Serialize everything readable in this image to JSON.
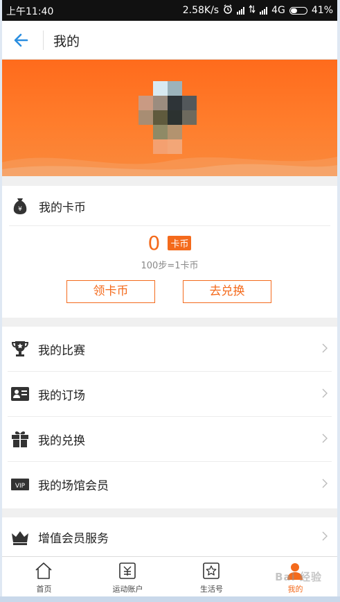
{
  "status_bar": {
    "time": "上午11:40",
    "net_speed": "2.58K/s",
    "network": "4G",
    "battery": "41%",
    "battery_level": 0.41
  },
  "header": {
    "title": "我的",
    "back_icon": "arrow-left-icon"
  },
  "coins": {
    "title": "我的卡币",
    "icon": "money-bag-icon",
    "amount": "0",
    "unit_badge": "卡币",
    "rate": "100步=1卡币",
    "get_button": "领卡币",
    "exchange_button": "去兑换"
  },
  "menu": {
    "items": [
      {
        "label": "我的比赛",
        "icon": "trophy-icon"
      },
      {
        "label": "我的订场",
        "icon": "id-card-icon"
      },
      {
        "label": "我的兑换",
        "icon": "gift-icon"
      },
      {
        "label": "我的场馆会员",
        "icon": "vip-badge-icon"
      }
    ]
  },
  "vip_service": {
    "label": "增值会员服务",
    "icon": "crown-icon"
  },
  "tabbar": {
    "items": [
      {
        "label": "首页",
        "icon": "home-icon",
        "active": false
      },
      {
        "label": "运动账户",
        "icon": "account-icon",
        "active": false
      },
      {
        "label": "生活号",
        "icon": "star-icon",
        "active": false
      },
      {
        "label": "我的",
        "icon": "user-icon",
        "active": true
      }
    ],
    "watermark": "Bai 经验"
  },
  "colors": {
    "accent": "#f46a1c",
    "header_link": "#2a8ee0",
    "hero": "#ff6b1c"
  }
}
